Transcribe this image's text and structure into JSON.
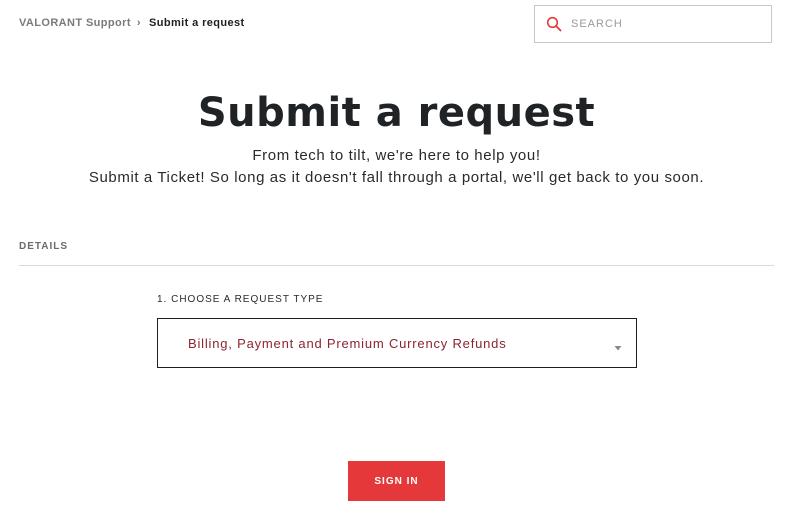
{
  "breadcrumb": {
    "home": "VALORANT Support",
    "separator": "›",
    "current": "Submit a request"
  },
  "search": {
    "placeholder": "SEARCH",
    "icon": "search-icon",
    "icon_color": "#e5383b"
  },
  "hero": {
    "title": "Submit a request",
    "subtitle_line1": "From tech to tilt, we're here to help you!",
    "subtitle_line2": "Submit a Ticket! So long as it doesn't fall through a portal, we'll get back to you soon."
  },
  "details": {
    "label": "DETAILS"
  },
  "request_type": {
    "label": "1. CHOOSE A REQUEST TYPE",
    "selected": "Billing, Payment and Premium Currency Refunds",
    "icon": "chevron-down-icon"
  },
  "sign_in": {
    "label": "SIGN IN"
  },
  "colors": {
    "accent": "#e5383b",
    "selected_text": "#8b2530"
  }
}
